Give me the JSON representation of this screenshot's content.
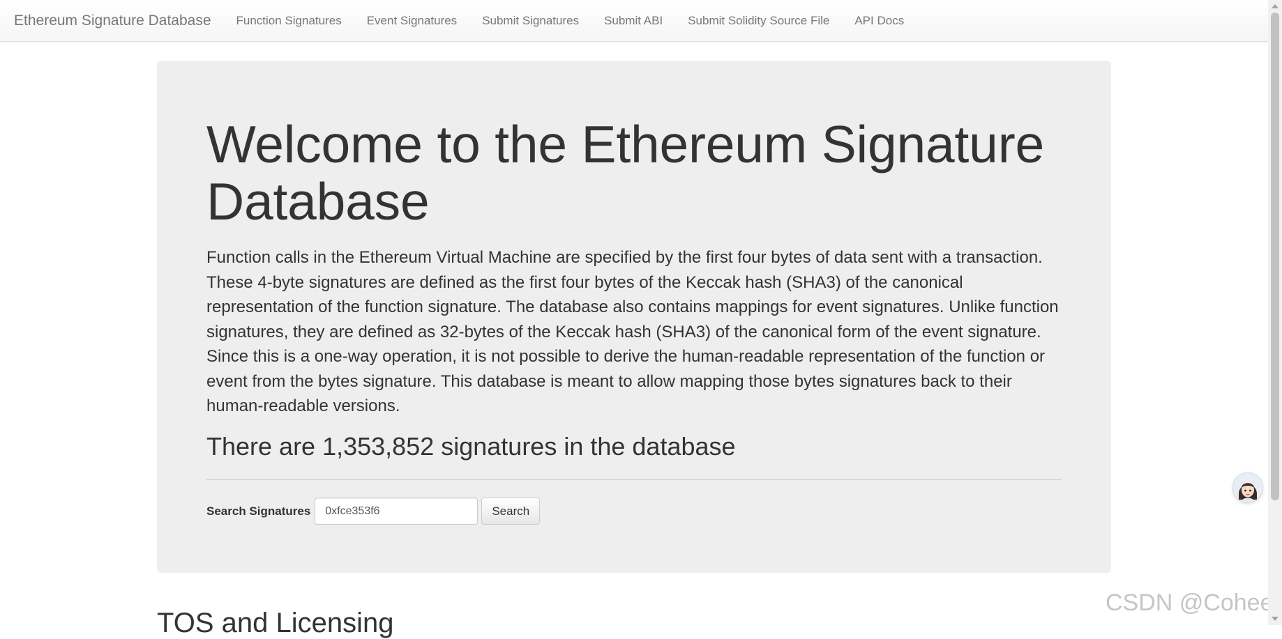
{
  "navbar": {
    "brand": "Ethereum Signature Database",
    "links": [
      "Function Signatures",
      "Event Signatures",
      "Submit Signatures",
      "Submit ABI",
      "Submit Solidity Source File",
      "API Docs"
    ]
  },
  "jumbotron": {
    "heading": "Welcome to the Ethereum Signature Database",
    "intro": "Function calls in the Ethereum Virtual Machine are specified by the first four bytes of data sent with a transaction. These 4-byte signatures are defined as the first four bytes of the Keccak hash (SHA3) of the canonical representation of the function signature. The database also contains mappings for event signatures. Unlike function signatures, they are defined as 32-bytes of the Keccak hash (SHA3) of the canonical form of the event signature. Since this is a one-way operation, it is not possible to derive the human-readable representation of the function or event from the bytes signature. This database is meant to allow mapping those bytes signatures back to their human-readable versions.",
    "count_text": "There are 1,353,852 signatures in the database"
  },
  "search": {
    "label": "Search Signatures",
    "value": "0xfce353f6",
    "button_label": "Search"
  },
  "next_section": {
    "heading": "TOS and Licensing"
  },
  "overlay": {
    "watermark": "CSDN @CoheeY",
    "avatar_icon": "assistant-avatar-icon"
  }
}
